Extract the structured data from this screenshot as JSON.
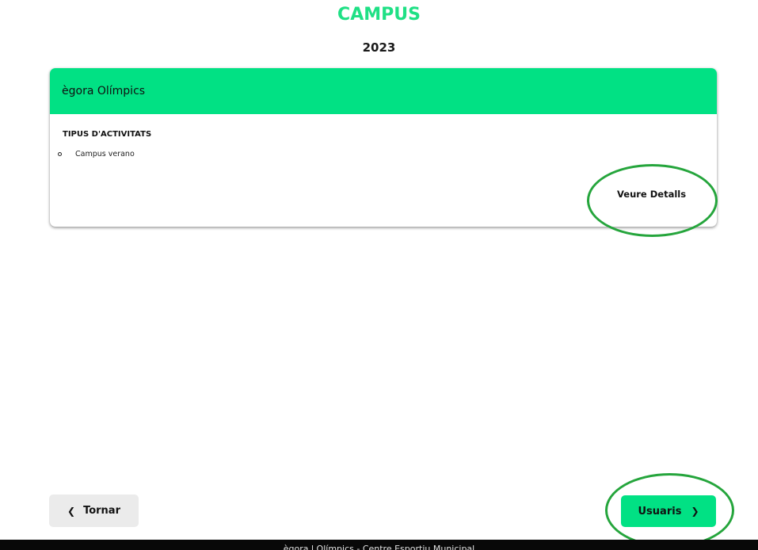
{
  "header": {
    "title": "CAMPUS",
    "year": "2023"
  },
  "card": {
    "title": "ègora Olímpics",
    "section_title": "TIPUS D'ACTIVITATS",
    "activities": [
      "Campus verano"
    ],
    "details_label": "Veure Detalls"
  },
  "nav": {
    "back_label": "Tornar",
    "back_icon": "chevron-left-icon",
    "next_label": "Usuaris",
    "next_icon": "chevron-right-icon"
  },
  "footer": {
    "text": "ègora l Olímpics - Centre Esportiu Municipal"
  },
  "colors": {
    "accent": "#01e184",
    "title_green": "#1fe085",
    "annotation_oval": "#25a53c",
    "footer_bg": "#080808"
  }
}
